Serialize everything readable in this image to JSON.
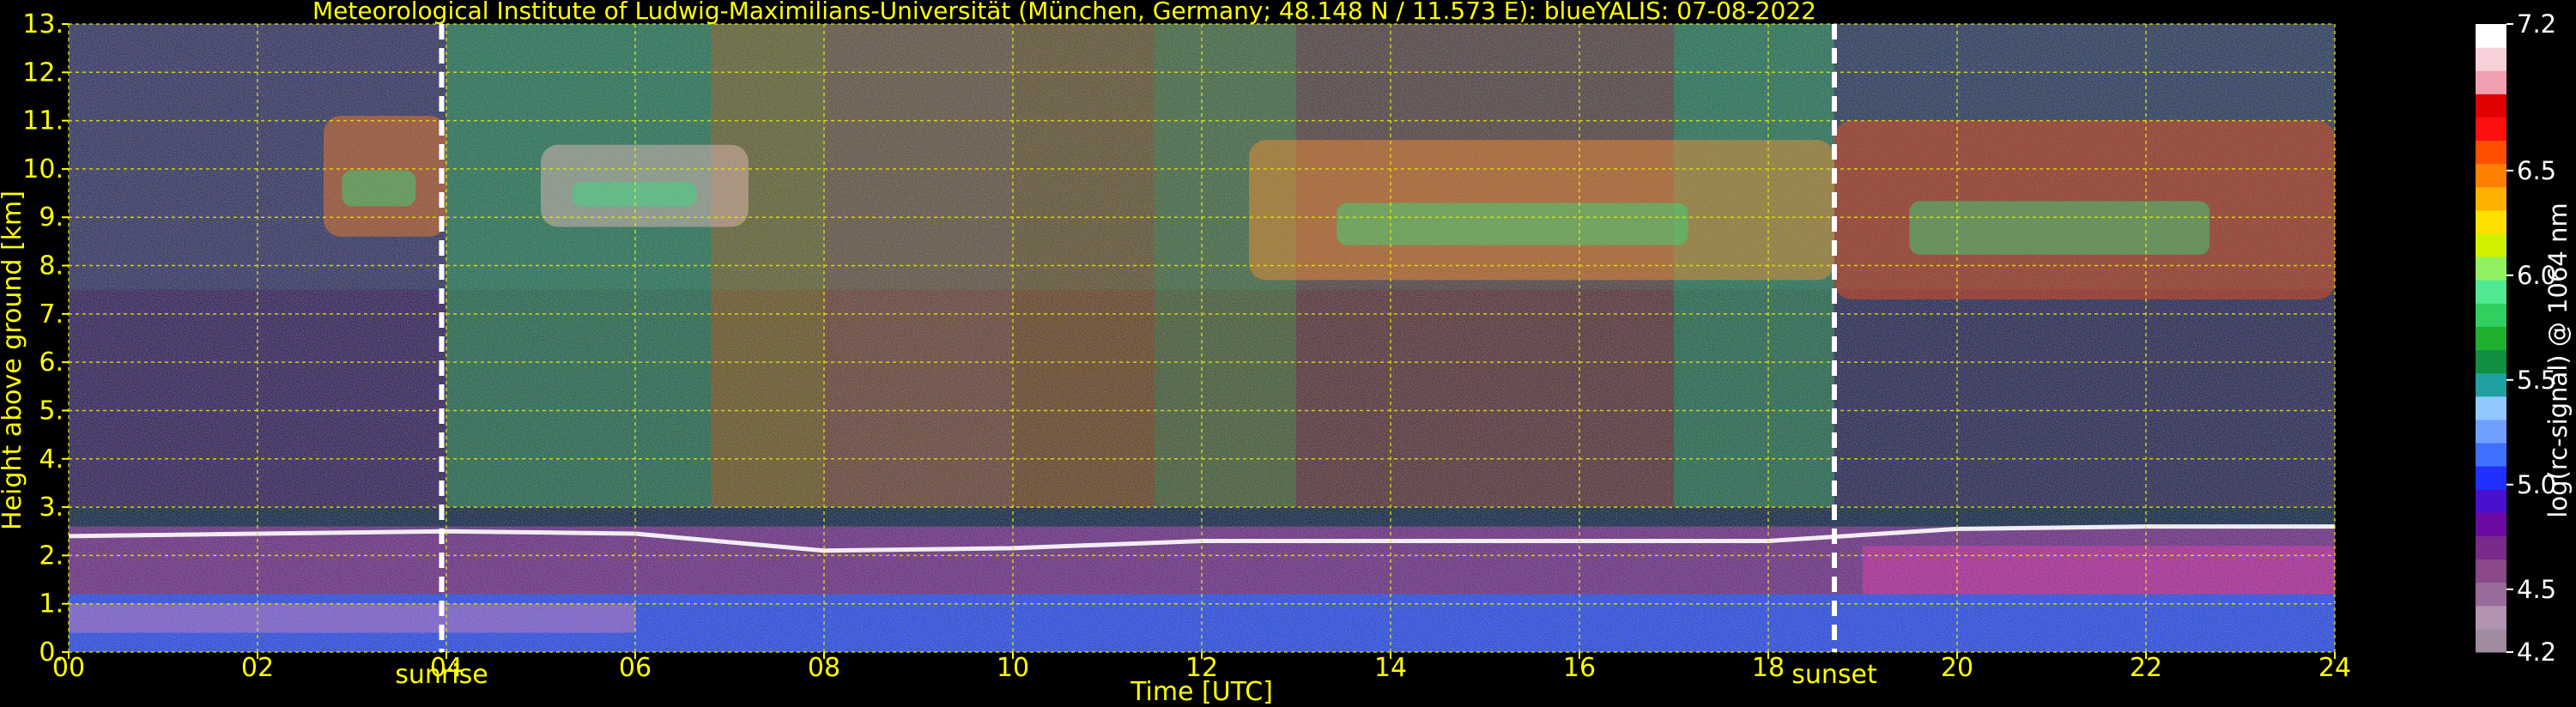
{
  "chart_data": {
    "type": "heatmap",
    "title": "Meteorological Institute of Ludwig-Maximilians-Universität (München, Germany; 48.148 N / 11.573 E):     blueYALIS: 07-08-2022",
    "xlabel": "Time [UTC]",
    "ylabel": "Height above ground [km]",
    "xlim": [
      0,
      24
    ],
    "ylim": [
      0,
      13
    ],
    "x_ticks": [
      "00",
      "02",
      "04",
      "06",
      "08",
      "10",
      "12",
      "14",
      "16",
      "18",
      "20",
      "22",
      "24"
    ],
    "y_ticks": [
      "0.",
      "1.",
      "2.",
      "3.",
      "4.",
      "5.",
      "6.",
      "7.",
      "8.",
      "9.",
      "10.",
      "11.",
      "12.",
      "13."
    ],
    "grid": true,
    "markers": [
      {
        "label": "sunrise",
        "x": 3.95
      },
      {
        "label": "sunset",
        "x": 18.7
      }
    ],
    "colorbar": {
      "label": "log(rc-signal) @ 1064 nm",
      "range": [
        4.2,
        7.2
      ],
      "ticks": [
        "4.2",
        "4.5",
        "5.0",
        "5.5",
        "6.0",
        "6.5",
        "7.2"
      ],
      "colors": [
        "#a08aa0",
        "#b094b0",
        "#9a6a9a",
        "#8a4a8a",
        "#7a2a8a",
        "#6a0aa0",
        "#4a10d0",
        "#2030ff",
        "#4070ff",
        "#70a0ff",
        "#90c8ff",
        "#20a0a0",
        "#109040",
        "#20b030",
        "#30d060",
        "#50e890",
        "#90f060",
        "#d0f000",
        "#ffe000",
        "#ffb000",
        "#ff8000",
        "#ff5000",
        "#ff1010",
        "#e00000",
        "#f0a0b0",
        "#f8d0d8",
        "#ffffff"
      ]
    },
    "features": [
      {
        "name": "boundary layer top",
        "x": [
          0,
          2,
          4,
          6,
          8,
          10,
          12,
          14,
          16,
          18,
          20,
          22,
          24
        ],
        "y": [
          2.4,
          2.45,
          2.5,
          2.45,
          2.1,
          2.15,
          2.3,
          2.3,
          2.3,
          2.3,
          2.55,
          2.6,
          2.6
        ]
      },
      {
        "name": "cirrus",
        "segments": [
          [
            2.7,
            4.0,
            8.6,
            11.1
          ],
          [
            5.0,
            7.2,
            8.8,
            10.5
          ],
          [
            12.5,
            18.7,
            7.7,
            10.6
          ],
          [
            18.7,
            24,
            7.3,
            11.0
          ]
        ]
      }
    ]
  }
}
